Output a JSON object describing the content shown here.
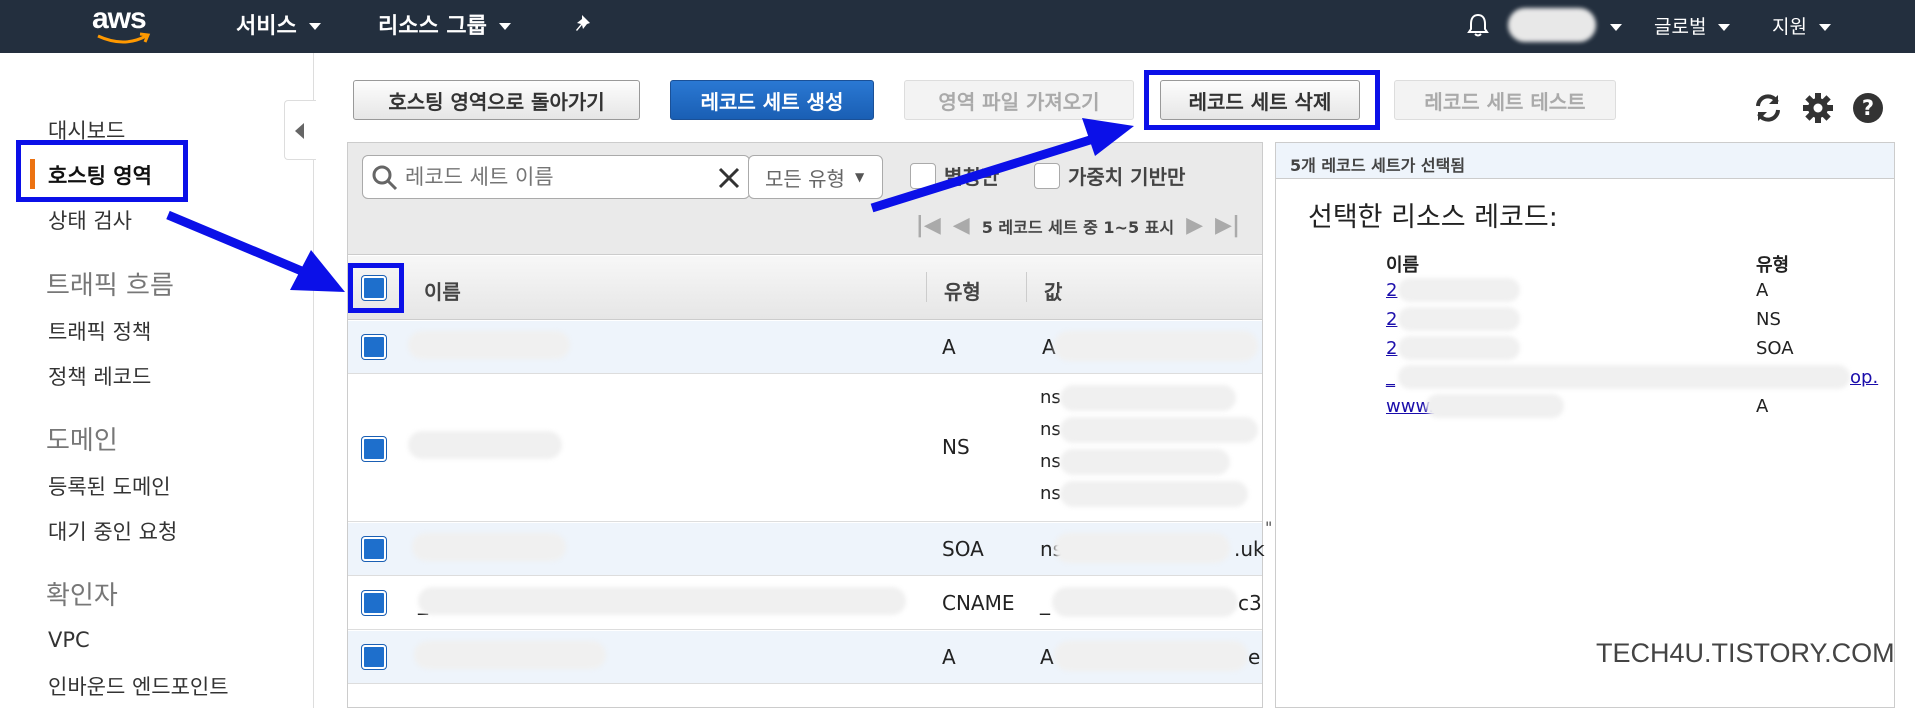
{
  "topbar": {
    "logo": "aws",
    "services": "서비스",
    "resource_groups": "리소스 그룹",
    "region": "글로벌",
    "support": "지원",
    "icons": [
      "bell-icon",
      "pin-icon"
    ]
  },
  "sidebar": {
    "items": [
      "대시보드",
      "호스팅 영역",
      "상태 검사"
    ],
    "traffic_head": "트래픽 흐름",
    "traffic_items": [
      "트래픽 정책",
      "정책 레코드"
    ],
    "domain_head": "도메인",
    "domain_items": [
      "등록된 도메인",
      "대기 중인 요청"
    ],
    "resolver_head": "확인자",
    "resolver_items": [
      "VPC",
      "인바운드 엔드포인트"
    ]
  },
  "toolbar": {
    "back": "호스팅 영역으로 돌아가기",
    "create": "레코드 세트 생성",
    "import": "영역 파일 가져오기",
    "delete": "레코드 세트 삭제",
    "test": "레코드 세트 테스트"
  },
  "filter": {
    "search_placeholder": "레코드 세트 이름",
    "type_select": "모든 유형",
    "alias_only": "별칭만",
    "weighted_only": "가중치 기반만",
    "pager": "5 레코드 세트 중 1~5 표시"
  },
  "table": {
    "headers": {
      "name": "이름",
      "type": "유형",
      "value": "값"
    },
    "rows": [
      {
        "type": "A",
        "value": "A"
      },
      {
        "type": "NS",
        "value": [
          "ns",
          "ns",
          "ns",
          "ns"
        ]
      },
      {
        "type": "SOA",
        "value": "ns",
        "value_tail": ".uk"
      },
      {
        "type": "CNAME",
        "value": "_",
        "value_tail": "c3",
        "name_prefix": "_"
      },
      {
        "type": "A",
        "value": "A",
        "value_tail": "e"
      }
    ]
  },
  "right_panel": {
    "header": "5개 레코드 세트가 선택됨",
    "title": "선택한 리소스 레코드:",
    "col_name": "이름",
    "col_type": "유형",
    "records": [
      {
        "name": "2",
        "type": "A"
      },
      {
        "name": "2",
        "type": "NS"
      },
      {
        "name": "2",
        "type": "SOA"
      },
      {
        "name": "_",
        "name_tail": "op.",
        "type": ""
      },
      {
        "name": "www.",
        "type": "A"
      }
    ]
  },
  "watermark": "TECH4U.TISTORY.COM",
  "colors": {
    "topbar": "#232f3e",
    "primary": "#1a5fb4",
    "highlight": "#0b10e8",
    "active_marker": "#ec7211"
  }
}
